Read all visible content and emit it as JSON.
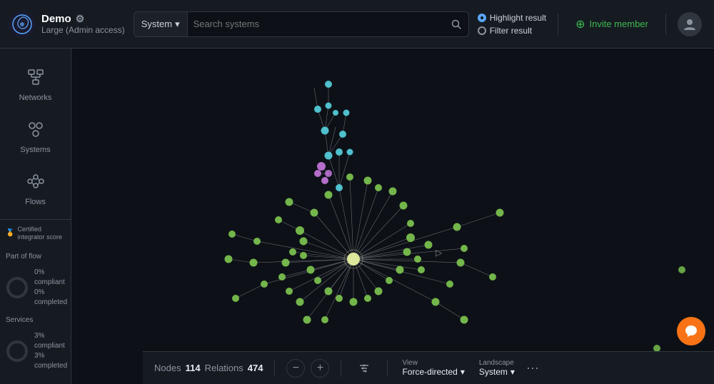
{
  "header": {
    "logo_title": "Demo",
    "logo_subtitle": "Large (Admin access)",
    "search_type": "System",
    "search_placeholder": "Search systems",
    "highlight_label": "Highlight result",
    "filter_label": "Filter result",
    "invite_label": "Invite member"
  },
  "sidebar": {
    "items": [
      {
        "id": "networks",
        "label": "Networks"
      },
      {
        "id": "systems",
        "label": "Systems"
      },
      {
        "id": "flows",
        "label": "Flows"
      }
    ],
    "score_title": "Certified integrator score",
    "part_of_flow_label": "Part of flow",
    "part_compliant": "0% compliant",
    "part_completed": "0% completed",
    "services_label": "Services",
    "services_compliant": "3% compliant",
    "services_completed": "3% completed"
  },
  "graph": {
    "nodes_label": "Nodes",
    "nodes_count": "114",
    "relations_label": "Relations",
    "relations_count": "474"
  },
  "bottom_bar": {
    "view_label": "View",
    "view_value": "Force-directed",
    "landscape_label": "Landscape",
    "landscape_value": "System"
  },
  "colors": {
    "accent_green": "#39d353",
    "accent_cyan": "#56d3e0",
    "accent_purple": "#c678dd",
    "accent_orange": "#f97316",
    "node_center": "#e0e0a0"
  }
}
